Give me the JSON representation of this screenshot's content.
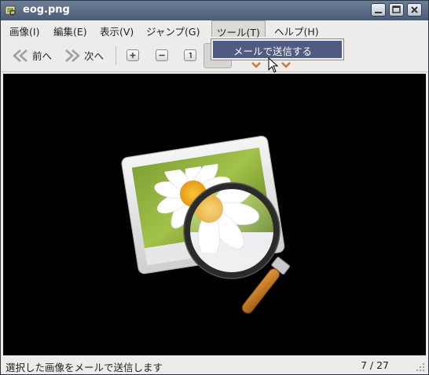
{
  "window": {
    "title": "eog.png",
    "icon": "eog-app-icon"
  },
  "menubar": {
    "items": [
      {
        "label": "画像(I)"
      },
      {
        "label": "編集(E)"
      },
      {
        "label": "表示(V)"
      },
      {
        "label": "ジャンプ(G)"
      },
      {
        "label": "ツール(T)"
      },
      {
        "label": "ヘルプ(H)"
      }
    ],
    "active": "ツール(T)"
  },
  "toolbar": {
    "prev_label": "前へ",
    "next_label": "次へ"
  },
  "dropdown": {
    "items": [
      {
        "label": "メールで送信する",
        "highlighted": true
      }
    ]
  },
  "statusbar": {
    "message": "選択した画像をメールで送信します",
    "position": "7 / 27"
  },
  "colors": {
    "titlebar": "#5b6c84",
    "menu_highlight": "#4f5b80",
    "viewer_bg": "#000000"
  }
}
